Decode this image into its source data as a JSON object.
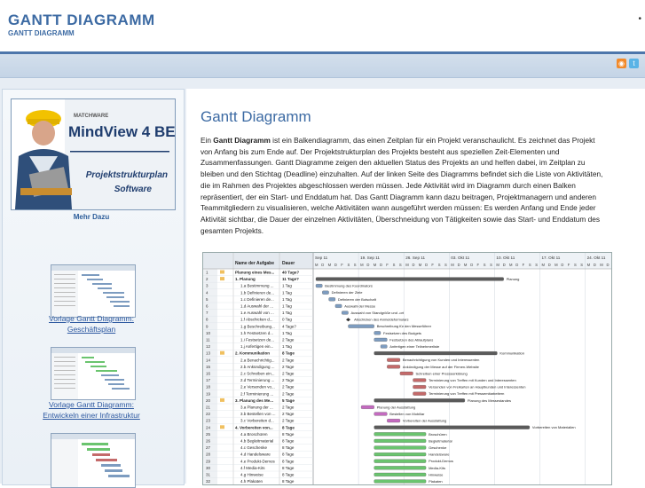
{
  "header": {
    "site_title": "GANTT DIAGRAMM",
    "site_subtitle": "GANTT DIAGRAMM"
  },
  "sidebar": {
    "product": {
      "brand": "MATCHWARE",
      "name": "MindView 4 BE",
      "tagline_line1": "Projektstrukturplan",
      "tagline_line2": "Software"
    },
    "more_link": "Mehr Dazu",
    "templates": [
      {
        "label_line1": "Vorlage Gantt Diagramm:",
        "label_line2": "Geschäftsplan"
      },
      {
        "label_line1": "Vorlage Gantt Diagramm:",
        "label_line2": "Entwickeln einer Infrastruktur"
      }
    ]
  },
  "article": {
    "title": "Gantt Diagramm",
    "intro_prefix": "Ein ",
    "intro_bold": "Gantt Diagramm",
    "intro_rest": " ist ein Balkendiagramm, das einen Zeitplan für ein Projekt veranschaulicht. Es zeichnet das Projekt von Anfang bis zum Ende auf. Der Projektstrukturplan des Projekts besteht aus speziellen Zeit-Elementen und Zusammenfassungen. Gantt Diagramme zeigen den aktuellen Status des Projekts an und helfen dabei, im Zeitplan zu bleiben und den Stichtag (Deadline) einzuhalten. Auf der linken Seite des Diagramms befindet sich die Liste von Aktivitäten, die im Rahmen des Projektes abgeschlossen werden müssen. Jede Aktivität wird im Diagramm durch einen Balken repräsentiert, der ein Start- und Enddatum hat. Das Gantt Diagramm kann dazu beitragen, Projektmanagern und anderen Teammitgliedern zu visualisieren, welche Aktivitäten wann ausgeführt werden müssen: Es werden Anfang und Ende jeder Aktivität sichtbar, die Dauer der einzelnen Aktivitäten, Überschneidung von Tätigkeiten sowie das Start- und Enddatum des gesamten Projekts."
  },
  "gantt": {
    "col_name": "Name der Aufgabe",
    "col_duration": "Dauer",
    "weeks": [
      "Sep 11",
      "19. Sep 11",
      "26. Sep 11",
      "03. Okt 11",
      "10. Okt 11",
      "17. Okt 11",
      "24. Okt 11"
    ],
    "day_letters": [
      "M",
      "D",
      "M",
      "D",
      "F",
      "S",
      "S"
    ],
    "rows": [
      {
        "n": "1",
        "name": "Planung eines Mes...",
        "dur": "40 Tage?",
        "group": true
      },
      {
        "n": "2",
        "name": "1. Planung",
        "dur": "11 Tage?",
        "group": true
      },
      {
        "n": "3",
        "name": "1.a Bestimmung ...",
        "dur": "1 Tag",
        "group": false
      },
      {
        "n": "4",
        "name": "1.b Definieren de...",
        "dur": "1 Tag",
        "group": false
      },
      {
        "n": "5",
        "name": "1.c Definieren de...",
        "dur": "1 Tag",
        "group": false
      },
      {
        "n": "6",
        "name": "1.d Auswahl der ...",
        "dur": "1 Tag",
        "group": false
      },
      {
        "n": "7",
        "name": "1.e Auswahl von ...",
        "dur": "1 Tag",
        "group": false
      },
      {
        "n": "8",
        "name": "1.f Abschicken d...",
        "dur": "0 Tag",
        "group": false
      },
      {
        "n": "9",
        "name": "1.g Beschreibung...",
        "dur": "4 Tage?",
        "group": false
      },
      {
        "n": "10",
        "name": "1.h Festsetzen d...",
        "dur": "1 Tag",
        "group": false
      },
      {
        "n": "11",
        "name": "1.i Festsetzen de...",
        "dur": "2 Tage",
        "group": false
      },
      {
        "n": "12",
        "name": "1.j Anfertigen ein...",
        "dur": "1 Tag",
        "group": false
      },
      {
        "n": "13",
        "name": "2. Kommunikation",
        "dur": "8 Tage",
        "group": true
      },
      {
        "n": "14",
        "name": "2.a Benachrichtig...",
        "dur": "2 Tage",
        "group": false
      },
      {
        "n": "15",
        "name": "2.b Ankündigung ...",
        "dur": "2 Tage",
        "group": false
      },
      {
        "n": "16",
        "name": "2.c Schreiben ein...",
        "dur": "2 Tage",
        "group": false
      },
      {
        "n": "17",
        "name": "2.d Terminierung ...",
        "dur": "2 Tage",
        "group": false
      },
      {
        "n": "18",
        "name": "2.e Versenden vo...",
        "dur": "2 Tage",
        "group": false
      },
      {
        "n": "19",
        "name": "2.f Terminierung ...",
        "dur": "2 Tage",
        "group": false
      },
      {
        "n": "20",
        "name": "3. Planung des Me...",
        "dur": "5 Tage",
        "group": true
      },
      {
        "n": "21",
        "name": "3.a Planung der ...",
        "dur": "2 Tage",
        "group": false
      },
      {
        "n": "22",
        "name": "3.b Bestellen von ...",
        "dur": "2 Tage",
        "group": false
      },
      {
        "n": "23",
        "name": "3.c Vorbereiten d...",
        "dur": "2 Tage",
        "group": false
      },
      {
        "n": "24",
        "name": "4. Vorbereiten von...",
        "dur": "8 Tage",
        "group": true
      },
      {
        "n": "25",
        "name": "4.a Broschüren",
        "dur": "8 Tage",
        "group": false
      },
      {
        "n": "26",
        "name": "4.b Begleitmaterial",
        "dur": "8 Tage",
        "group": false
      },
      {
        "n": "27",
        "name": "4.c Geschenke",
        "dur": "8 Tage",
        "group": false
      },
      {
        "n": "28",
        "name": "4.d Handelsware",
        "dur": "8 Tage",
        "group": false
      },
      {
        "n": "29",
        "name": "4.e Produkt-Demos",
        "dur": "8 Tage",
        "group": false
      },
      {
        "n": "30",
        "name": "4.f Media-Kits",
        "dur": "8 Tage",
        "group": false
      },
      {
        "n": "31",
        "name": "4.g Hinweise",
        "dur": "8 Tage",
        "group": false
      },
      {
        "n": "32",
        "name": "4.h Plakaten",
        "dur": "8 Tage",
        "group": false
      }
    ],
    "bars": [
      {
        "row": 1,
        "start": 0,
        "len": 29,
        "color": "#5a5a5a",
        "label": "Planung"
      },
      {
        "row": 2,
        "start": 0,
        "len": 1,
        "color": "#7d9cc0",
        "label": "Bestimmung des Koordinators"
      },
      {
        "row": 3,
        "start": 1,
        "len": 1,
        "color": "#7d9cc0",
        "label": "Definieren der Ziele"
      },
      {
        "row": 4,
        "start": 2,
        "len": 1,
        "color": "#7d9cc0",
        "label": "Definieren der Botschaft"
      },
      {
        "row": 5,
        "start": 3,
        "len": 1,
        "color": "#7d9cc0",
        "label": "Auswahl der Messe"
      },
      {
        "row": 6,
        "start": 4,
        "len": 1,
        "color": "#7d9cc0",
        "label": "Auswahl von Standgröße und -ort"
      },
      {
        "row": 7,
        "start": 5,
        "len": 0,
        "color": "#333333",
        "label": "Abschicken des Anmeldeformulars"
      },
      {
        "row": 8,
        "start": 5,
        "len": 4,
        "color": "#7d9cc0",
        "label": "Beschreibung für den Messeführer"
      },
      {
        "row": 9,
        "start": 9,
        "len": 1,
        "color": "#7d9cc0",
        "label": "Festsetzen des Budgets"
      },
      {
        "row": 10,
        "start": 9,
        "len": 2,
        "color": "#7d9cc0",
        "label": "Festsetzen des Ablaufplans"
      },
      {
        "row": 11,
        "start": 10,
        "len": 1,
        "color": "#7d9cc0",
        "label": "Anfertigen einer Teilnehmerliste"
      },
      {
        "row": 12,
        "start": 9,
        "len": 19,
        "color": "#5a5a5a",
        "label": "Kommunikation"
      },
      {
        "row": 13,
        "start": 11,
        "len": 2,
        "color": "#c46a6a",
        "label": "Benachrichtigung von Kunden und Interessenten"
      },
      {
        "row": 14,
        "start": 11,
        "len": 2,
        "color": "#c46a6a",
        "label": "Ankündigung der Messe auf der Firmen-Website"
      },
      {
        "row": 15,
        "start": 13,
        "len": 2,
        "color": "#c46a6a",
        "label": "Schreiben einer Presseerklärung"
      },
      {
        "row": 16,
        "start": 15,
        "len": 2,
        "color": "#c46a6a",
        "label": "Terminierung von Treffen mit Kunden und Interessenten"
      },
      {
        "row": 17,
        "start": 15,
        "len": 2,
        "color": "#c46a6a",
        "label": "Versenden von Freikarten an Hauptkunden und Interessenten"
      },
      {
        "row": 18,
        "start": 15,
        "len": 2,
        "color": "#c46a6a",
        "label": "Terminierung von Treffen mit Pressemitarbeitern"
      },
      {
        "row": 19,
        "start": 9,
        "len": 14,
        "color": "#5a5a5a",
        "label": "Planung des Messestandes"
      },
      {
        "row": 20,
        "start": 7,
        "len": 2,
        "color": "#c46ac0",
        "label": "Planung der Ausstattung"
      },
      {
        "row": 21,
        "start": 9,
        "len": 2,
        "color": "#c46ac0",
        "label": "Bestellen von Mobiliar"
      },
      {
        "row": 22,
        "start": 11,
        "len": 2,
        "color": "#c46ac0",
        "label": "Vorbereiten der Ausstattung"
      },
      {
        "row": 23,
        "start": 9,
        "len": 24,
        "color": "#5a5a5a",
        "label": "Vorbereiten von Materialien"
      },
      {
        "row": 24,
        "start": 9,
        "len": 8,
        "color": "#6ac46e",
        "label": "Broschüren"
      },
      {
        "row": 25,
        "start": 9,
        "len": 8,
        "color": "#6ac46e",
        "label": "Begleitmaterial"
      },
      {
        "row": 26,
        "start": 9,
        "len": 8,
        "color": "#6ac46e",
        "label": "Geschenke"
      },
      {
        "row": 27,
        "start": 9,
        "len": 8,
        "color": "#6ac46e",
        "label": "Handelsware"
      },
      {
        "row": 28,
        "start": 9,
        "len": 8,
        "color": "#6ac46e",
        "label": "Produkt-Demos"
      },
      {
        "row": 29,
        "start": 9,
        "len": 8,
        "color": "#6ac46e",
        "label": "Media-Kits"
      },
      {
        "row": 30,
        "start": 9,
        "len": 8,
        "color": "#6ac46e",
        "label": "Hinweise"
      },
      {
        "row": 31,
        "start": 9,
        "len": 8,
        "color": "#6ac46e",
        "label": "Plakaten"
      }
    ]
  },
  "colors": {
    "accent": "#3c6aa3",
    "header_rule": "#4d76ab",
    "link": "#2c58a0"
  }
}
